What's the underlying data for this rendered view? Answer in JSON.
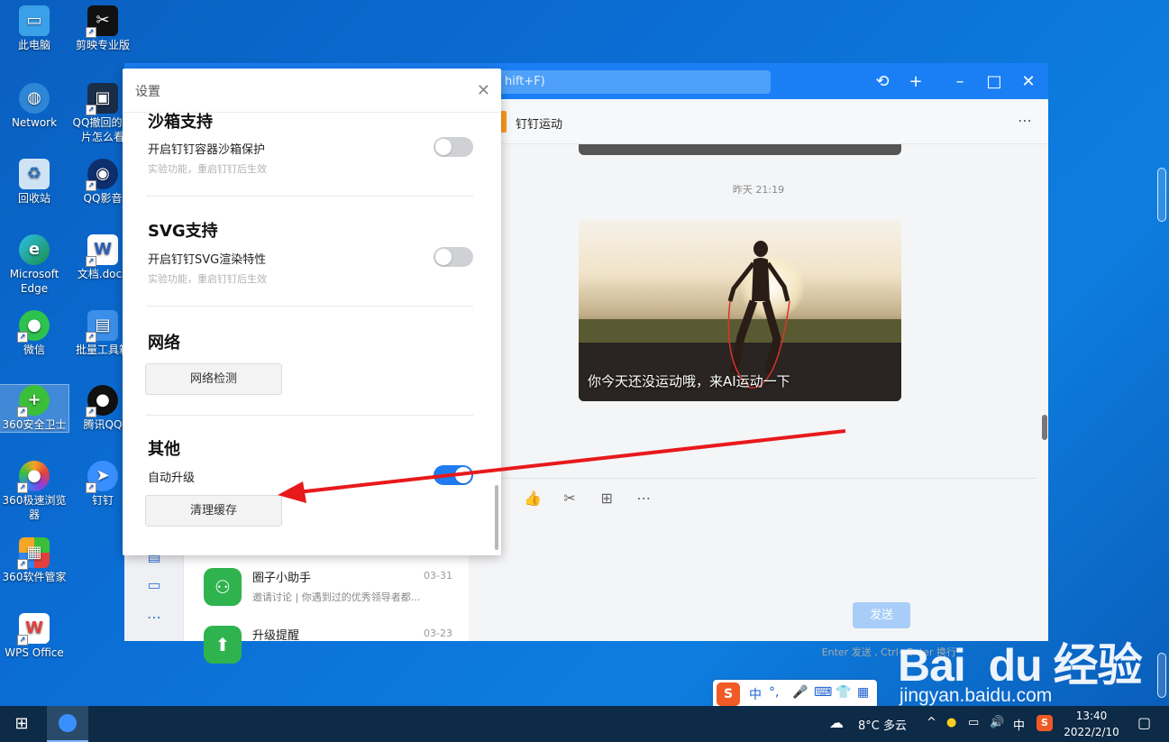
{
  "desktop": {
    "icons": [
      {
        "label": "此电脑"
      },
      {
        "label": "剪映专业版"
      },
      {
        "label": "Network"
      },
      {
        "label": "QQ撤回的图片怎么看"
      },
      {
        "label": "回收站"
      },
      {
        "label": "QQ影音"
      },
      {
        "label": "Microsoft Edge"
      },
      {
        "label": "文档.docx"
      },
      {
        "label": "微信"
      },
      {
        "label": "批量工具箱"
      },
      {
        "label": "360安全卫士"
      },
      {
        "label": "腾讯QQ"
      },
      {
        "label": "360极速浏览器"
      },
      {
        "label": "钉钉"
      },
      {
        "label": "360软件管家"
      },
      {
        "label": "WPS Office"
      }
    ]
  },
  "app": {
    "search_placeholder": "hift+F)",
    "chat_title": "钉钉运动",
    "timestamp": "昨天 21:19",
    "card_caption": "你今天还没运动哦，来AI运动一下",
    "conversations": [
      {
        "title": "圈子小助手",
        "time": "03-31",
        "preview": "邀请讨论 | 你遇到过的优秀领导者都..."
      },
      {
        "title": "升级提醒",
        "time": "03-23",
        "preview": ""
      }
    ],
    "input_hint": "Enter 发送 , Ctrl+Enter 换行",
    "send_label": "发送"
  },
  "settings": {
    "title": "设置",
    "sandbox": {
      "heading": "沙箱支持",
      "label": "开启钉钉容器沙箱保护",
      "note": "实验功能，重启钉钉后生效",
      "enabled": false
    },
    "svg": {
      "heading": "SVG支持",
      "label": "开启钉钉SVG渲染特性",
      "note": "实验功能，重启钉钉后生效",
      "enabled": false
    },
    "network": {
      "heading": "网络",
      "button": "网络检测"
    },
    "other": {
      "heading": "其他",
      "auto_update_label": "自动升级",
      "auto_update": true,
      "clear_cache_button": "清理缓存"
    }
  },
  "ime": {
    "mode": "中"
  },
  "watermark": {
    "logo": "Bai  du 经验",
    "url": "jingyan.baidu.com"
  },
  "taskbar": {
    "weather": "8°C 多云",
    "ime_indicator": "中",
    "time": "13:40",
    "date": "2022/2/10"
  },
  "colors": {
    "accent": "#1a7ff5",
    "arrow": "#e8191b",
    "desktop": "#0b6fd6"
  }
}
